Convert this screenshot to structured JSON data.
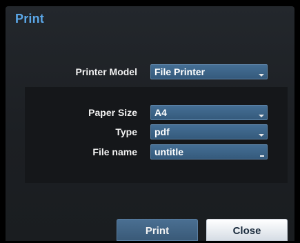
{
  "dialog": {
    "title": "Print"
  },
  "printer_model": {
    "label": "Printer Model",
    "value": "File Printer"
  },
  "paper_size": {
    "label": "Paper Size",
    "value": "A4"
  },
  "type": {
    "label": "Type",
    "value": "pdf"
  },
  "file_name": {
    "label": "File name",
    "value": "untitle"
  },
  "buttons": {
    "print": "Print",
    "close": "Close"
  },
  "colors": {
    "title": "#5ba7e8",
    "field": "#3d6488",
    "background": "#1c1f23",
    "panel": "#15171a"
  },
  "icons": {
    "dropdown": "chevron-down-icon",
    "text_cursor": "text-cursor-icon"
  }
}
